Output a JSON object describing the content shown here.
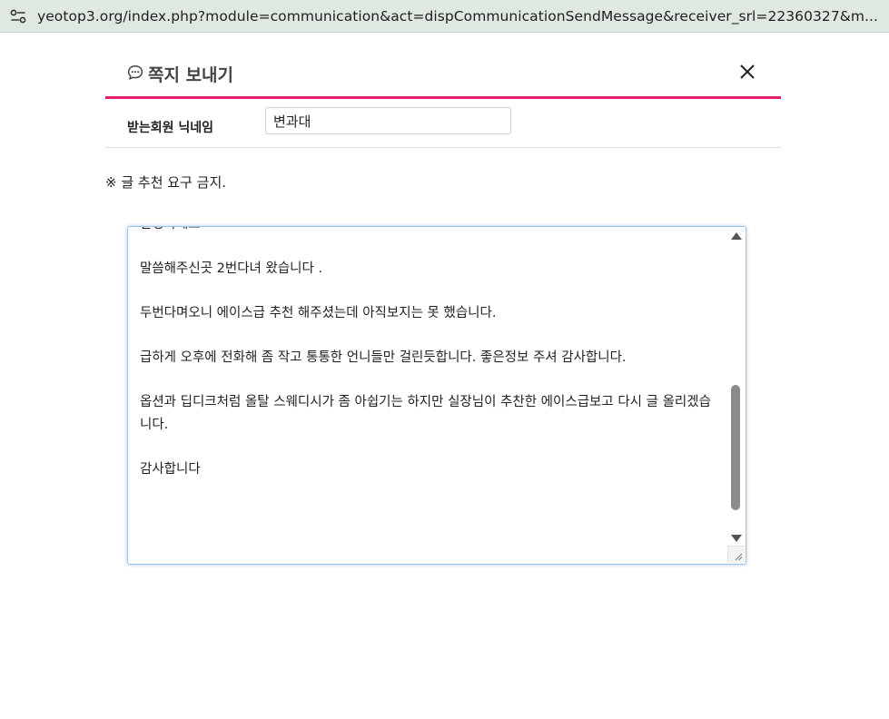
{
  "browser": {
    "url": "yeotop3.org/index.php?module=communication&act=dispCommunicationSendMessage&receiver_srl=22360327&m...",
    "site_info_icon": "tune-icon"
  },
  "dialog": {
    "title": "쪽지 보내기",
    "title_icon": "chat-bubble-icon",
    "close_icon": "close-icon",
    "accent_color": "#e41e6d"
  },
  "recipient": {
    "label": "받는회원 닉네임",
    "value": "변과대"
  },
  "notice": "※ 글 추천 요구 금지.",
  "message": {
    "partial_top_line": "안녕하세요",
    "lines": [
      "",
      "말씀해주신곳 2번다녀 왔습니다 .",
      "",
      "두번다며오니 에이스급 추천 해주셨는데 아직보지는 못 했습니다.",
      "",
      "급하게 오후에 전화해 좀 작고 통통한 언니들만 걸린듯합니다. 좋은정보 주셔 감사합니다.",
      "",
      "옵션과 딥디크처럼 올탈 스웨디시가 좀 아쉽기는 하지만 실장님이 추찬한 에이스급보고 다시 글 올리겠습니다.",
      "",
      "감사합니다"
    ]
  }
}
